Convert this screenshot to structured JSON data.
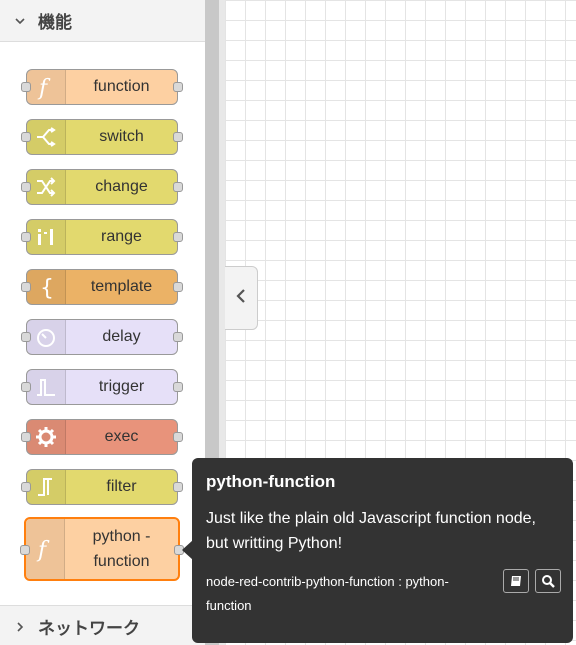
{
  "palette": {
    "categories": [
      {
        "label": "機能",
        "expanded": true
      },
      {
        "label": "ネットワーク",
        "expanded": false
      }
    ],
    "nodes": [
      {
        "label": "function",
        "color": "#fdd0a2",
        "icon": "function-icon"
      },
      {
        "label": "switch",
        "color": "#e2d96e",
        "icon": "switch-icon"
      },
      {
        "label": "change",
        "color": "#e2d96e",
        "icon": "shuffle-icon"
      },
      {
        "label": "range",
        "color": "#e2d96e",
        "icon": "range-icon"
      },
      {
        "label": "template",
        "color": "#ebb266",
        "icon": "template-icon"
      },
      {
        "label": "delay",
        "color": "#e6e0f8",
        "icon": "timer-icon"
      },
      {
        "label": "trigger",
        "color": "#e6e0f8",
        "icon": "trigger-icon"
      },
      {
        "label": "exec",
        "color": "#e8937b",
        "icon": "cog-icon"
      },
      {
        "label": "filter",
        "color": "#e2d96e",
        "icon": "filter-icon"
      },
      {
        "label_line1": "python -",
        "label_line2": "function",
        "color": "#fdd0a2",
        "icon": "function-icon",
        "selected": true
      }
    ]
  },
  "tooltip": {
    "title": "python-function",
    "description": "Just like the plain old Javascript function node, but writting Python!",
    "module": "node-red-contrib-python-function : python-function",
    "buttons": [
      "book-icon",
      "search-icon"
    ]
  },
  "colors": {
    "accent": "#ff7f0e",
    "tooltip_bg": "#333333"
  }
}
